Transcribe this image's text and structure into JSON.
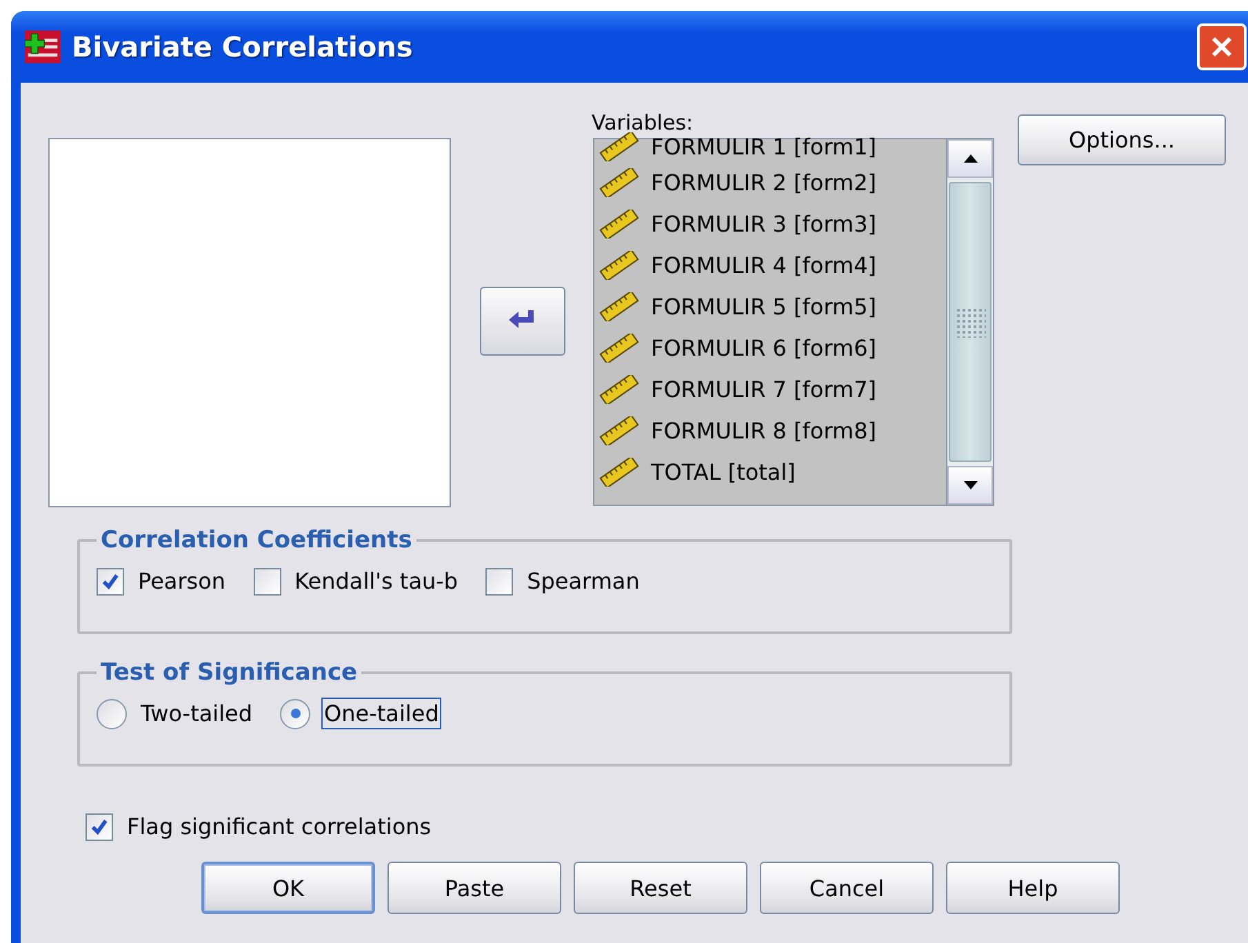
{
  "window": {
    "title": "Bivariate Correlations"
  },
  "variables": {
    "label": "Variables:",
    "items": [
      {
        "label": "FORMULIR 1 [form1]"
      },
      {
        "label": "FORMULIR 2 [form2]"
      },
      {
        "label": "FORMULIR 3 [form3]"
      },
      {
        "label": "FORMULIR 4 [form4]"
      },
      {
        "label": "FORMULIR 5 [form5]"
      },
      {
        "label": "FORMULIR 6 [form6]"
      },
      {
        "label": "FORMULIR 7 [form7]"
      },
      {
        "label": "FORMULIR 8 [form8]"
      },
      {
        "label": "TOTAL [total]"
      }
    ]
  },
  "options_button": "Options...",
  "correlation_coefficients": {
    "title": "Correlation Coefficients",
    "options": [
      {
        "label": "Pearson",
        "checked": true
      },
      {
        "label": "Kendall's tau-b",
        "checked": false
      },
      {
        "label": "Spearman",
        "checked": false
      }
    ]
  },
  "test_of_significance": {
    "title": "Test of Significance",
    "options": [
      {
        "label": "Two-tailed",
        "selected": false,
        "focused": false
      },
      {
        "label": "One-tailed",
        "selected": true,
        "focused": true
      }
    ]
  },
  "flag_significant": {
    "label": "Flag significant correlations",
    "checked": true
  },
  "buttons": [
    {
      "label": "OK",
      "default": true
    },
    {
      "label": "Paste",
      "default": false
    },
    {
      "label": "Reset",
      "default": false
    },
    {
      "label": "Cancel",
      "default": false
    },
    {
      "label": "Help",
      "default": false
    }
  ]
}
